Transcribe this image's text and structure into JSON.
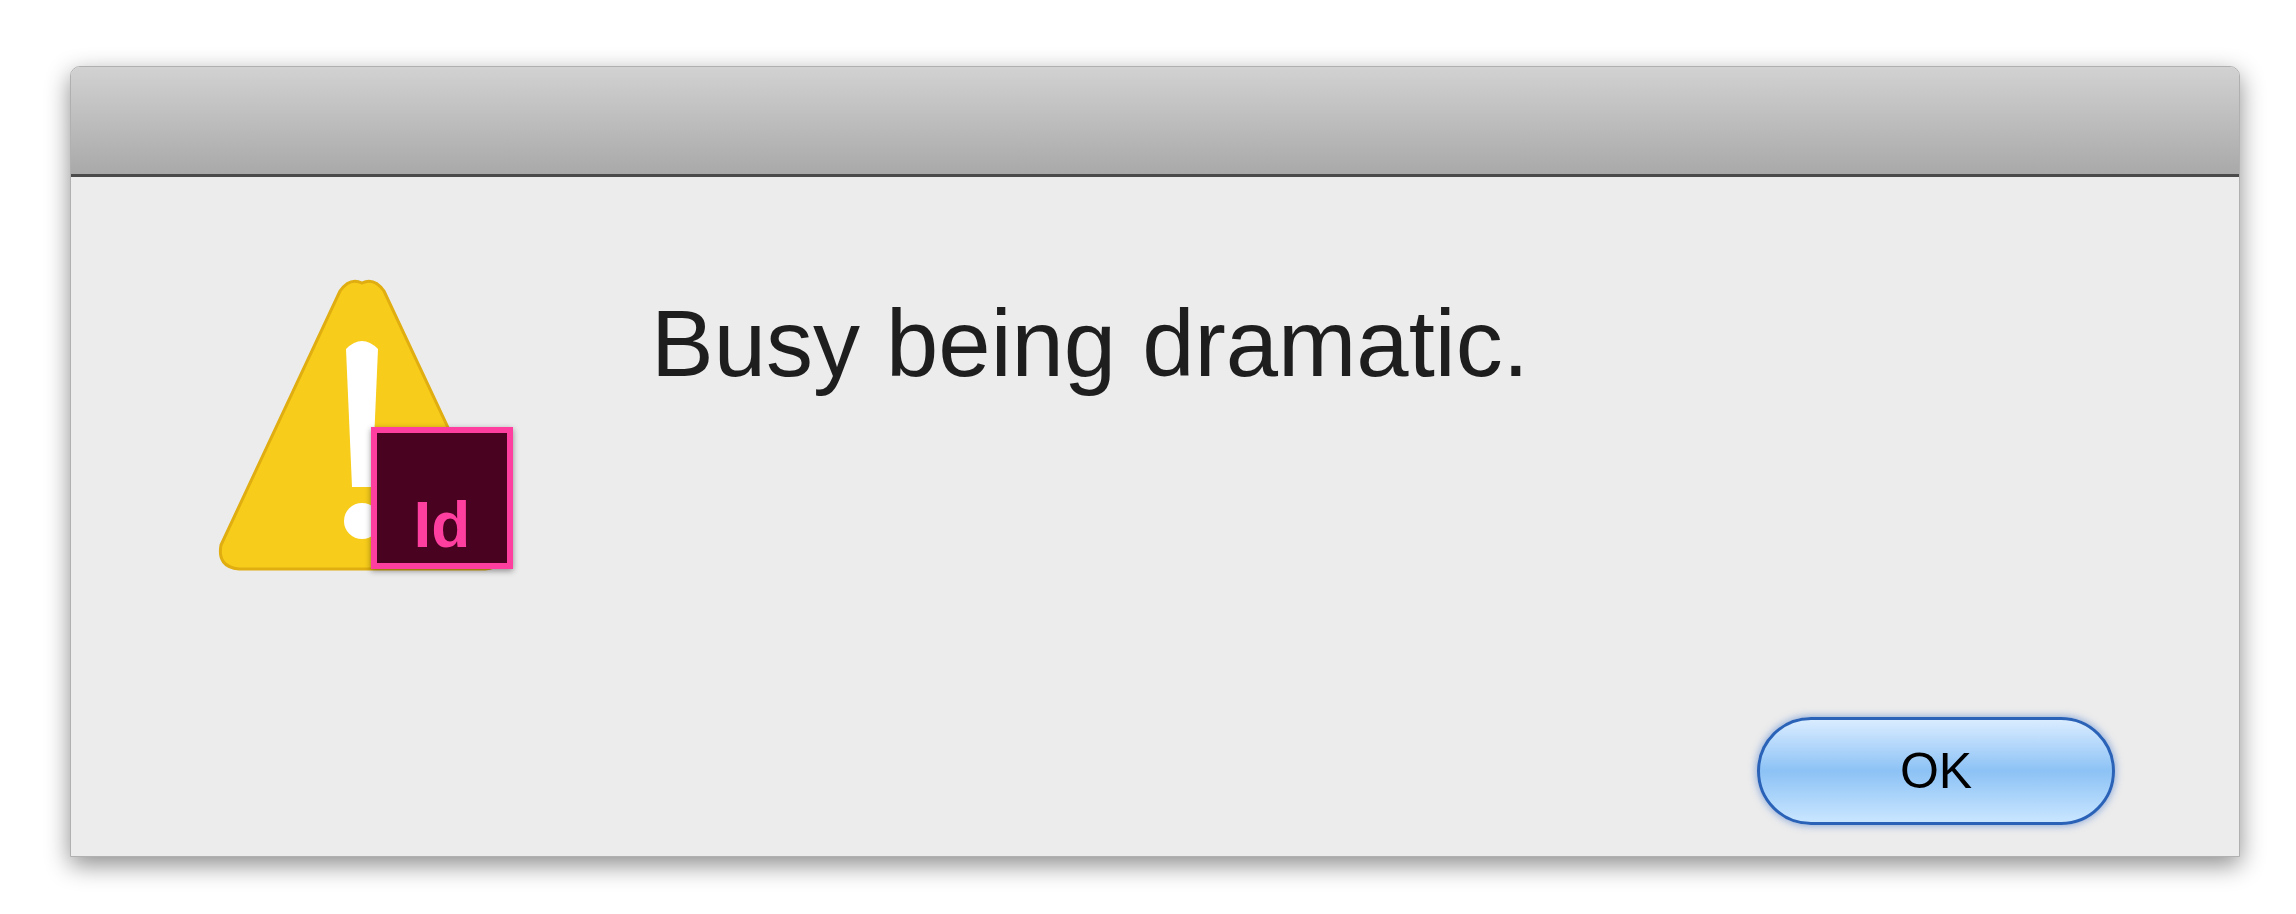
{
  "dialog": {
    "icon_badge": "Id",
    "message": "Busy being dramatic.",
    "buttons": [
      {
        "label": "OK",
        "default": true
      }
    ]
  }
}
